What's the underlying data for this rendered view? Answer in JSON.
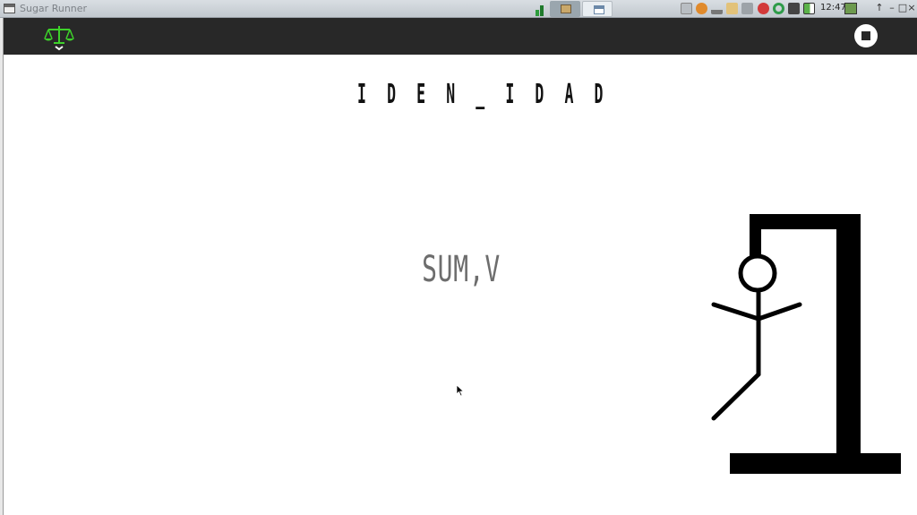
{
  "window": {
    "title": "Sugar Runner"
  },
  "system_tray": {
    "clock": "12:47",
    "icons": [
      "network-icon",
      "disabled-icon",
      "wifi-signal-icon",
      "folder-icon",
      "volume-icon",
      "record-icon",
      "sync-icon",
      "terminal-icon",
      "battery-icon",
      "image-viewer-icon"
    ]
  },
  "taskbar": {
    "tasks": [
      "image-app-task",
      "window-task"
    ]
  },
  "window_controls": [
    "up-arrow-icon",
    "minimize-icon",
    "maximize-icon",
    "close-icon"
  ],
  "toolbar": {
    "activity_icon": "scales-icon",
    "stop_icon": "stop-icon"
  },
  "game": {
    "secret_word_display": "I D E N _ I D A D",
    "wrong_letters": "SUM,V",
    "hangman_stage": "body, two arms and one leg drawn"
  },
  "colors": {
    "toolbar_bg": "#282828",
    "activity_icon": "#3dd12a",
    "canvas_bg": "#ffffff",
    "word_text": "#111111",
    "wrong_letters_text": "#6d6d6d",
    "gallows": "#000000"
  }
}
